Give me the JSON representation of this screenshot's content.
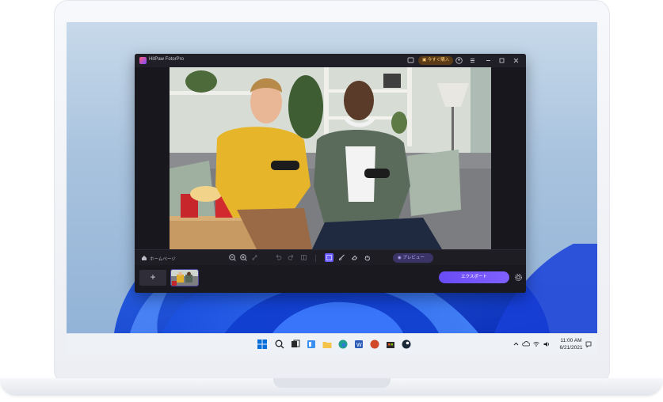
{
  "app": {
    "title": "HitPaw FotorPro",
    "buy_label": "今すぐ購入",
    "home_label": "ホームページ",
    "preview_label": "プレビュー",
    "export_label": "エクスポート",
    "add_label": "+"
  },
  "taskbar": {
    "time": "11:00 AM",
    "date": "6/21/2021"
  },
  "colors": {
    "accent": "#6b5cff",
    "export": "#6a4cf5",
    "buy_bg": "#5a3a17",
    "buy_text": "#ffcf7a",
    "app_bg": "#1c1b22"
  },
  "icons": [
    "windows-start-icon",
    "search-icon",
    "task-view-icon",
    "widgets-icon",
    "file-explorer-icon",
    "edge-icon",
    "word-icon",
    "powerpoint-icon",
    "store-icon",
    "steam-icon",
    "chevron-up-icon",
    "cloud-icon",
    "wifi-icon",
    "volume-icon",
    "notification-icon"
  ]
}
